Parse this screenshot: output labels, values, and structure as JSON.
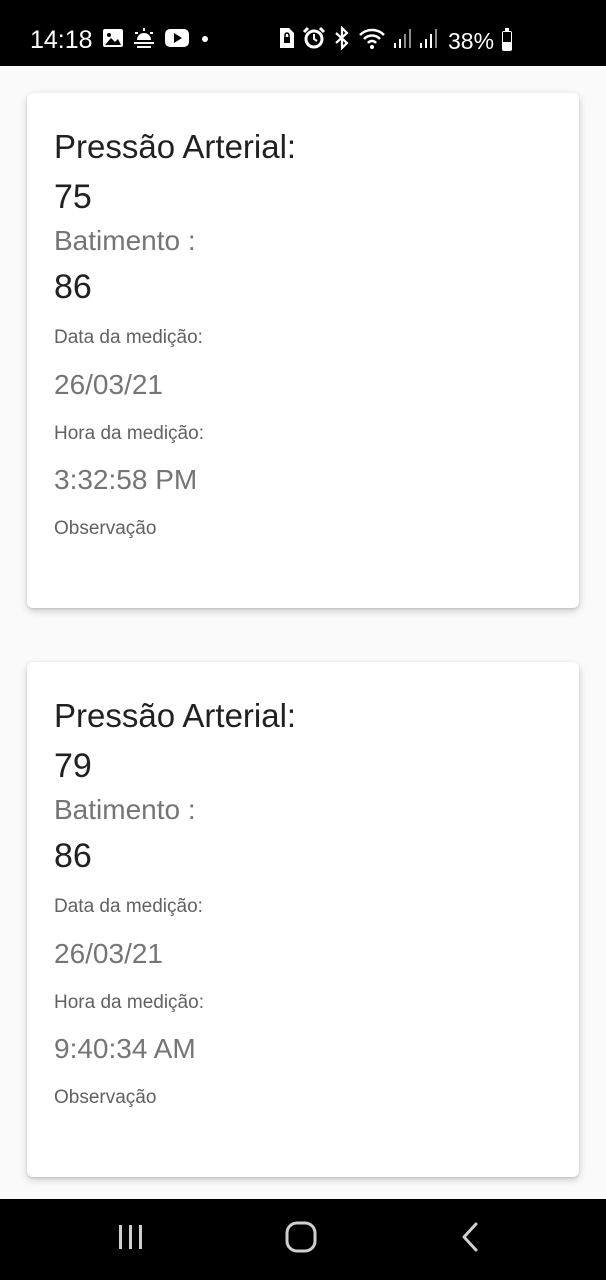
{
  "status_bar": {
    "time": "14:18",
    "battery": "38%",
    "left_icons": [
      "gallery-icon",
      "weather-icon",
      "youtube-icon",
      "dot-icon"
    ],
    "right_icons": [
      "sim-lock-icon",
      "alarm-icon",
      "bluetooth-icon",
      "wifi-icon",
      "signal-icon",
      "signal-icon",
      "battery-icon"
    ]
  },
  "records": [
    {
      "title": "Pressão Arterial:",
      "pressure": "75",
      "beat_label": "Batimento :",
      "beat_value": "86",
      "date_label": "Data da medição:",
      "date_value": "26/03/21",
      "time_label": "Hora da medição:",
      "time_value": "3:32:58 PM",
      "obs_label": "Observação"
    },
    {
      "title": "Pressão Arterial:",
      "pressure": "79",
      "beat_label": "Batimento :",
      "beat_value": "86",
      "date_label": "Data da medição:",
      "date_value": "26/03/21",
      "time_label": "Hora da medição:",
      "time_value": "9:40:34 AM",
      "obs_label": "Observação"
    }
  ],
  "nav_bar": {
    "buttons": [
      "recent-apps-icon",
      "home-icon",
      "back-icon"
    ]
  },
  "colors": {
    "status_bar_bg": "#000000",
    "content_bg": "#fafafa",
    "card_bg": "#ffffff",
    "primary_text": "#212121",
    "secondary_text": "#757575"
  }
}
